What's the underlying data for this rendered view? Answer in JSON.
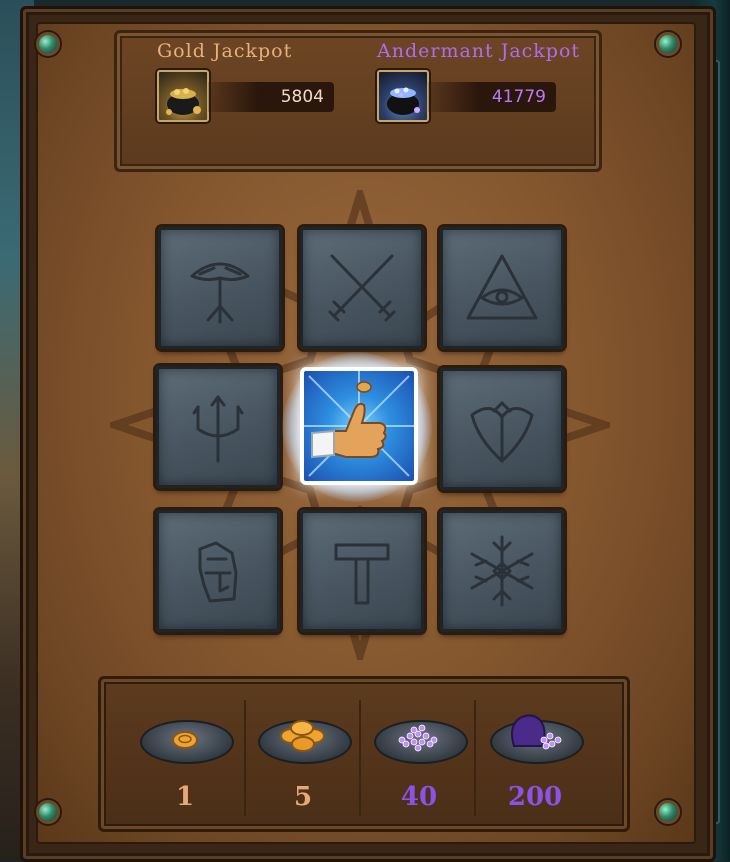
{
  "jackpots": {
    "gold": {
      "label": "Gold  Jackpot",
      "value": "5804",
      "color": "#e8b07a"
    },
    "andermant": {
      "label": "Andermant  Jackpot",
      "value": "41779",
      "color": "#b06cf0"
    }
  },
  "tiles": [
    {
      "icon": "tree-rune-icon"
    },
    {
      "icon": "crossed-swords-rune-icon"
    },
    {
      "icon": "eye-triangle-rune-icon"
    },
    {
      "icon": "trident-rune-icon"
    },
    {
      "icon": "thumbs-up-icon",
      "selected": true
    },
    {
      "icon": "bow-rune-icon"
    },
    {
      "icon": "gauntlet-rune-icon"
    },
    {
      "icon": "hammer-rune-icon"
    },
    {
      "icon": "snowflake-rune-icon"
    }
  ],
  "bets": [
    {
      "amount": "1",
      "currency": "gold",
      "icon": "single-coin-plate-icon"
    },
    {
      "amount": "5",
      "currency": "gold",
      "icon": "coin-pile-plate-icon"
    },
    {
      "amount": "40",
      "currency": "andermant",
      "icon": "andermant-pile-plate-icon"
    },
    {
      "amount": "200",
      "currency": "andermant",
      "icon": "andermant-sack-plate-icon"
    }
  ]
}
